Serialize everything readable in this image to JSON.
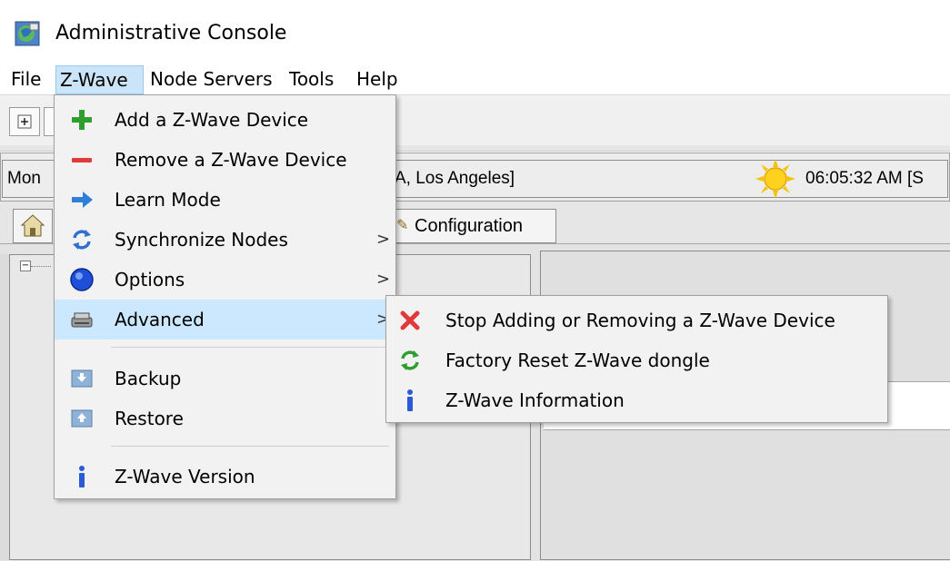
{
  "window": {
    "title": "Administrative Console"
  },
  "menubar": {
    "items": [
      {
        "label": "File"
      },
      {
        "label": "Z-Wave"
      },
      {
        "label": "Node Servers"
      },
      {
        "label": "Tools"
      },
      {
        "label": "Help"
      }
    ]
  },
  "status": {
    "left_text": "Mon",
    "location_text": "A, Los Angeles]",
    "time_text": "06:05:32 AM [S"
  },
  "tabs": {
    "config_label": "Configuration"
  },
  "zwave_menu": {
    "items": [
      {
        "label": "Add a Z-Wave Device",
        "icon": "plus-icon"
      },
      {
        "label": "Remove a Z-Wave Device",
        "icon": "minus-icon"
      },
      {
        "label": "Learn Mode",
        "icon": "arrow-right-icon"
      },
      {
        "label": "Synchronize Nodes",
        "icon": "sync-icon",
        "submenu": true
      },
      {
        "label": "Options",
        "icon": "options-icon",
        "submenu": true
      },
      {
        "label": "Advanced",
        "icon": "advanced-icon",
        "submenu": true,
        "highlighted": true
      },
      {
        "label": "Backup",
        "icon": "backup-icon"
      },
      {
        "label": "Restore",
        "icon": "restore-icon"
      },
      {
        "label": "Z-Wave Version",
        "icon": "info-icon"
      }
    ],
    "submenu_arrow": ">"
  },
  "advanced_submenu": {
    "items": [
      {
        "label": "Stop Adding or Removing a Z-Wave Device",
        "icon": "red-x-icon"
      },
      {
        "label": "Factory Reset Z-Wave dongle",
        "icon": "green-reset-icon"
      },
      {
        "label": "Z-Wave Information",
        "icon": "info-icon"
      }
    ]
  },
  "colors": {
    "menu_highlight": "#cce8ff",
    "plus_green": "#2e9e2e",
    "minus_red": "#e03a3a",
    "arrow_blue": "#2f7fd8",
    "info_blue": "#2a5bd7"
  }
}
